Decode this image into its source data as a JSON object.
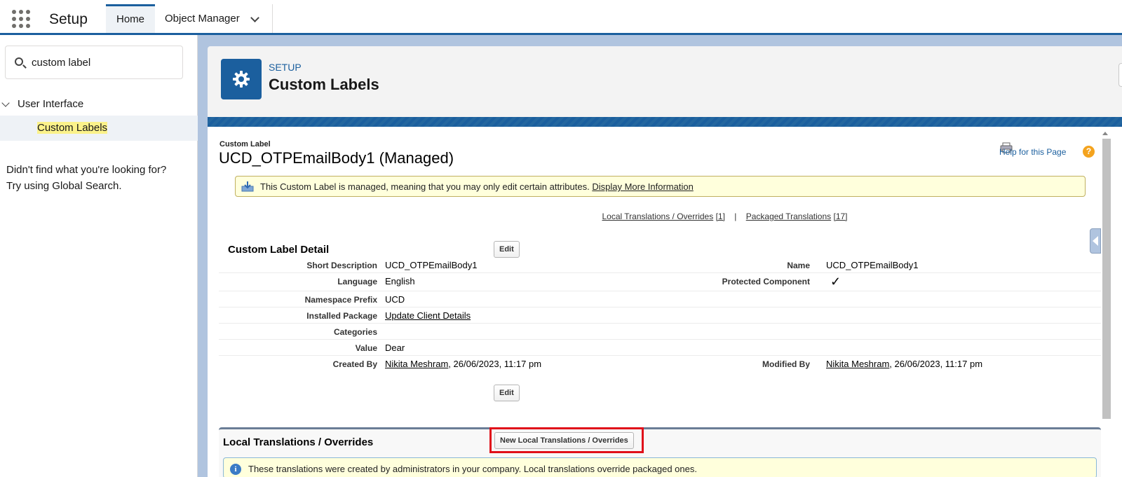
{
  "app": {
    "name": "Setup",
    "tabs": [
      {
        "label": "Home"
      },
      {
        "label": "Object Manager"
      }
    ]
  },
  "sidebar": {
    "search_value": "custom label",
    "group_label": "User Interface",
    "item_label": "Custom Labels",
    "not_found_line1": "Didn't find what you're looking for?",
    "not_found_line2": "Try using Global Search."
  },
  "header": {
    "eyebrow": "SETUP",
    "title": "Custom Labels"
  },
  "record": {
    "type_label": "Custom Label",
    "title": "UCD_OTPEmailBody1 (Managed)",
    "help_link": "Help for this Page",
    "managed_message": "This Custom Label is managed, meaning that you may only edit certain attributes.",
    "managed_link": "Display More Information",
    "related_link_1": "Local Translations / Overrides",
    "related_count_1": "[1]",
    "related_sep": "|",
    "related_link_2": "Packaged Translations",
    "related_count_2": "[17]"
  },
  "detail": {
    "section_title": "Custom Label Detail",
    "edit_label": "Edit",
    "fields": {
      "short_description_label": "Short Description",
      "short_description_value": "UCD_OTPEmailBody1",
      "name_label": "Name",
      "name_value": "UCD_OTPEmailBody1",
      "language_label": "Language",
      "language_value": "English",
      "protected_label": "Protected Component",
      "protected_checked": true,
      "namespace_label": "Namespace Prefix",
      "namespace_value": "UCD",
      "package_label": "Installed Package",
      "package_value": "Update Client Details",
      "categories_label": "Categories",
      "categories_value": "",
      "value_label": "Value",
      "value_value": "Dear",
      "created_by_label": "Created By",
      "created_by_user": "Nikita Meshram",
      "created_by_date": ", 26/06/2023, 11:17 pm",
      "modified_by_label": "Modified By",
      "modified_by_user": "Nikita Meshram",
      "modified_by_date": ", 26/06/2023, 11:17 pm"
    }
  },
  "local_translations": {
    "title": "Local Translations / Overrides",
    "new_button": "New Local Translations / Overrides",
    "info_message": "These translations were created by administrators in your company. Local translations override packaged ones."
  },
  "colors": {
    "brand": "#1b5f9e",
    "highlight_box": "#e0101a",
    "info_bg": "#ffffdc"
  },
  "icons": [
    "app-launcher-icon",
    "chevron-down-icon",
    "search-icon",
    "gear-icon",
    "printer-icon",
    "help-icon",
    "download-icon",
    "info-icon"
  ]
}
